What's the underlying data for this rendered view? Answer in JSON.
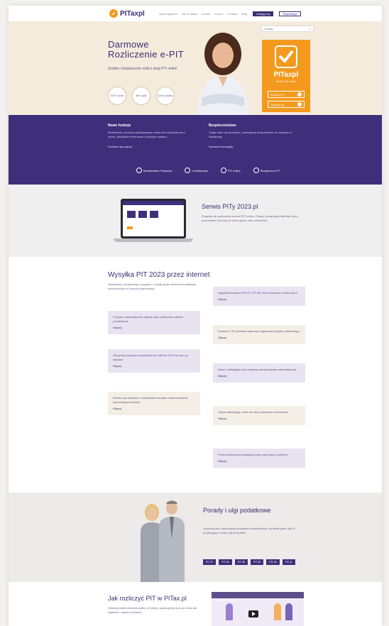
{
  "header": {
    "logo_text": "PITaxpl",
    "nav": [
      "Strona główna",
      "Jak to działa",
      "Cennik",
      "Pomoc",
      "Kontakt",
      "Blog"
    ],
    "btn_primary": "Zaloguj się",
    "btn_secondary": "Rejestracja"
  },
  "hero": {
    "title_line1": "Darmowe",
    "title_line2": "Rozliczenie e-PIT",
    "subtitle": "Szybko i bezpiecznie rozlicz swój PIT online",
    "badges": [
      "100% online",
      "Bez opłat",
      "Zwrot podatku"
    ],
    "search_placeholder": "Szukaj...",
    "panel_brand": "PITaxpl",
    "panel_tagline": "Rozlicz PIT online",
    "panel_btn1": "Rozlicz PIT",
    "panel_btn2": "Zaloguj się",
    "accent": "#f39a1e"
  },
  "purple": {
    "col1_title": "Nowe funkcje",
    "col1_text": "Rozliczenie zeznania podatkowego online bez wychodzenia z domu. Wszystkie formularze w jednym miejscu.",
    "col1_more": "Dowiedz się więcej",
    "col2_title": "Bezpieczeństwo",
    "col2_text": "Twoje dane są chronione i przesyłane bezpośrednio do systemu e-Deklaracje.",
    "col2_more": "Sprawdź szczegóły",
    "partners": [
      "Ministerstwo Finansów",
      "e-Deklaracje",
      "PIT online",
      "Bezpieczny PIT"
    ],
    "color": "#3d2f7a"
  },
  "product": {
    "title": "Serwis PITy 2023.pl",
    "text": "Program do rozliczania zeznań PIT online. Prosty i przejrzysty interfejs, który poprowadzi Cię krok po kroku przez całe rozliczenie."
  },
  "features": {
    "title": "Wysyłka PIT 2023 przez internet",
    "intro": "Skorzystaj z bezpłatnego programu i wyślij swoje zeznanie podatkowe bezpośrednio do urzędu skarbowego.",
    "link": "Więcej",
    "cards": [
      "Wypełnij formularz PIT-37, PIT-36 i inne zeznania w kilka minut.",
      "Program automatycznie wyliczy ulgi i odliczenia należne podatnikowi.",
      "Przekaż 1,5% podatku wybranej organizacji pożytku publicznego.",
      "Otrzymaj urzędowe poświadczenie odbioru UPO od razu po wysyłce.",
      "Dane z ubiegłego roku zostaną zaimportowane automatycznie.",
      "Rozlicz się wspólnie z małżonkiem lub jako osoba samotnie wychowująca dziecko.",
      "Zapisz deklarację i wróć do niej w dowolnym momencie.",
      "Pomoc techniczna dostępna przez cały sezon rozliczeń."
    ]
  },
  "people": {
    "title": "Porady i ulgi podatkowe",
    "text": "Zapoznaj się z aktualnymi przepisami podatkowymi, sprawdź jakie ulgi Ci przysługują i rozlicz się korzystnie.",
    "buttons": [
      "PIT-37",
      "PIT-36",
      "PIT-38",
      "PIT-28",
      "PIT-39",
      "PIT-11"
    ]
  },
  "last": {
    "title": "Jak rozliczyć PIT w PITax.pl",
    "text": "Obejrzyj krótki poradnik wideo, w którym pokazujemy krok po kroku jak wypełnić i wysłać zeznanie.",
    "video_title": "Poradnik PITax.pl"
  }
}
